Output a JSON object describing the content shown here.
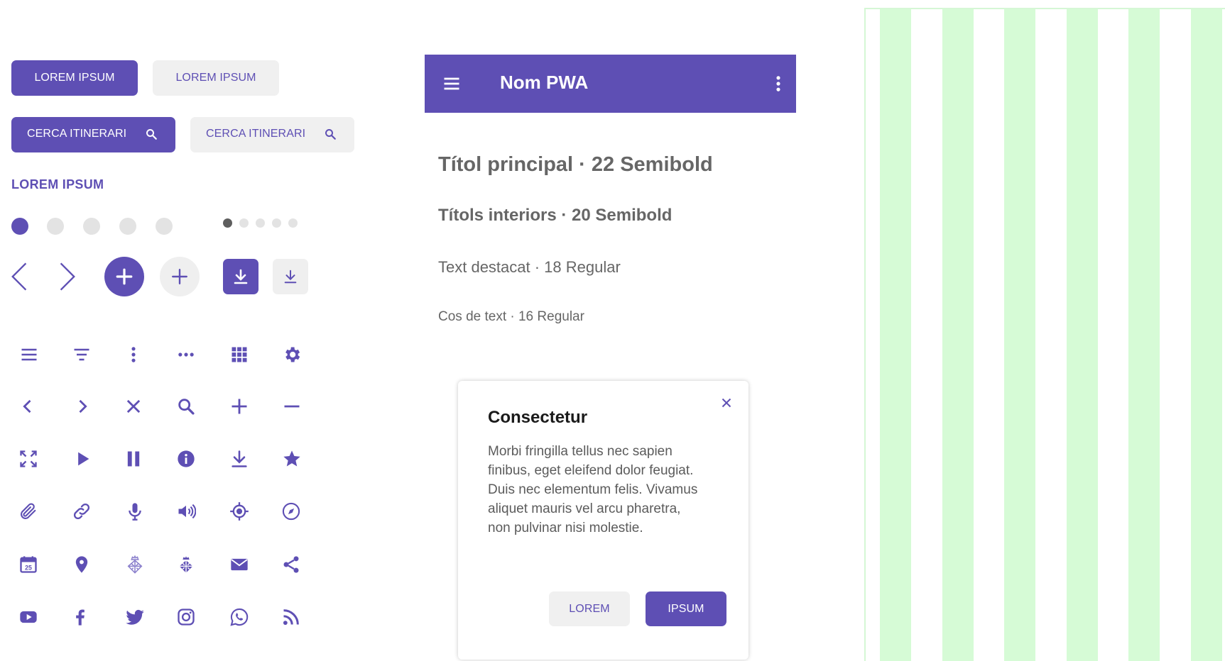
{
  "colors": {
    "accent": "#5e4fb4",
    "light_bg": "#f0f0f0",
    "grid": "#d6fbd6"
  },
  "buttons": {
    "primary_label": "LOREM IPSUM",
    "secondary_label": "LOREM IPSUM",
    "search_primary_label": "CERCA ITINERARI",
    "search_secondary_label": "CERCA ITINERARI",
    "text_link": "LOREM IPSUM"
  },
  "pagination": {
    "large_dots": 5,
    "large_active_index": 0,
    "small_dots": 5,
    "small_active_index": 0
  },
  "app_bar": {
    "title": "Nom PWA",
    "left_icon": "menu-icon",
    "right_icon": "more-vert-icon"
  },
  "typography": {
    "h1": "Títol principal · 22 Semibold",
    "h2": "Títols interiors · 20 Semibold",
    "highlight": "Text destacat · 18 Regular",
    "body": "Cos de text · 16 Regular"
  },
  "dialog": {
    "title": "Consectetur",
    "body": "Morbi fringilla tellus nec sapien finibus, eget eleifend dolor feugiat. Duis nec elementum felis. Vivamus aliquet mauris vel arcu pharetra, non pulvinar nisi molestie.",
    "cancel_label": "LOREM",
    "confirm_label": "IPSUM"
  },
  "icon_rows": [
    [
      "menu-icon",
      "filter-icon",
      "more-vert-icon",
      "more-horiz-icon",
      "apps-grid-icon",
      "gear-icon"
    ],
    [
      "chevron-left-icon",
      "chevron-right-icon",
      "close-icon",
      "search-icon",
      "plus-icon",
      "minus-icon"
    ],
    [
      "fullscreen-icon",
      "play-icon",
      "pause-icon",
      "info-icon",
      "download-icon",
      "star-icon"
    ],
    [
      "attachment-icon",
      "link-icon",
      "microphone-icon",
      "volume-icon",
      "gps-target-icon",
      "compass-icon"
    ],
    [
      "calendar-icon",
      "map-pin-icon",
      "barcelona-crest-outline-icon",
      "barcelona-crest-icon",
      "mail-icon",
      "share-icon"
    ],
    [
      "youtube-icon",
      "facebook-icon",
      "twitter-icon",
      "instagram-icon",
      "whatsapp-icon",
      "rss-icon"
    ]
  ],
  "calendar_day": "25"
}
